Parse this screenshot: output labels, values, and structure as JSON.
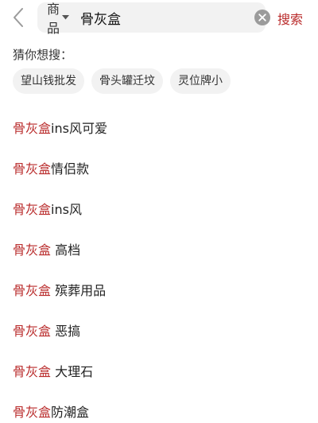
{
  "header": {
    "scope_label": "商品",
    "query_value": "骨灰盒",
    "search_label": "搜索"
  },
  "guess": {
    "title": "猜你想搜：",
    "chips": [
      "望山钱批发",
      "骨头罐迁坟",
      "灵位牌小"
    ]
  },
  "suggestions": [
    {
      "highlight": "骨灰盒",
      "rest": "ins风可爱"
    },
    {
      "highlight": "骨灰盒",
      "rest": "情侣款"
    },
    {
      "highlight": "骨灰盒",
      "rest": "ins风"
    },
    {
      "highlight": "骨灰盒",
      "rest": " 高档"
    },
    {
      "highlight": "骨灰盒",
      "rest": " 殡葬用品"
    },
    {
      "highlight": "骨灰盒",
      "rest": " 恶搞"
    },
    {
      "highlight": "骨灰盒",
      "rest": " 大理石"
    },
    {
      "highlight": "骨灰盒",
      "rest": "防潮盒"
    }
  ],
  "colors": {
    "accent": "#b92a2a",
    "chip_bg": "#f2f2f2",
    "search_bg": "#f2f2f2"
  }
}
